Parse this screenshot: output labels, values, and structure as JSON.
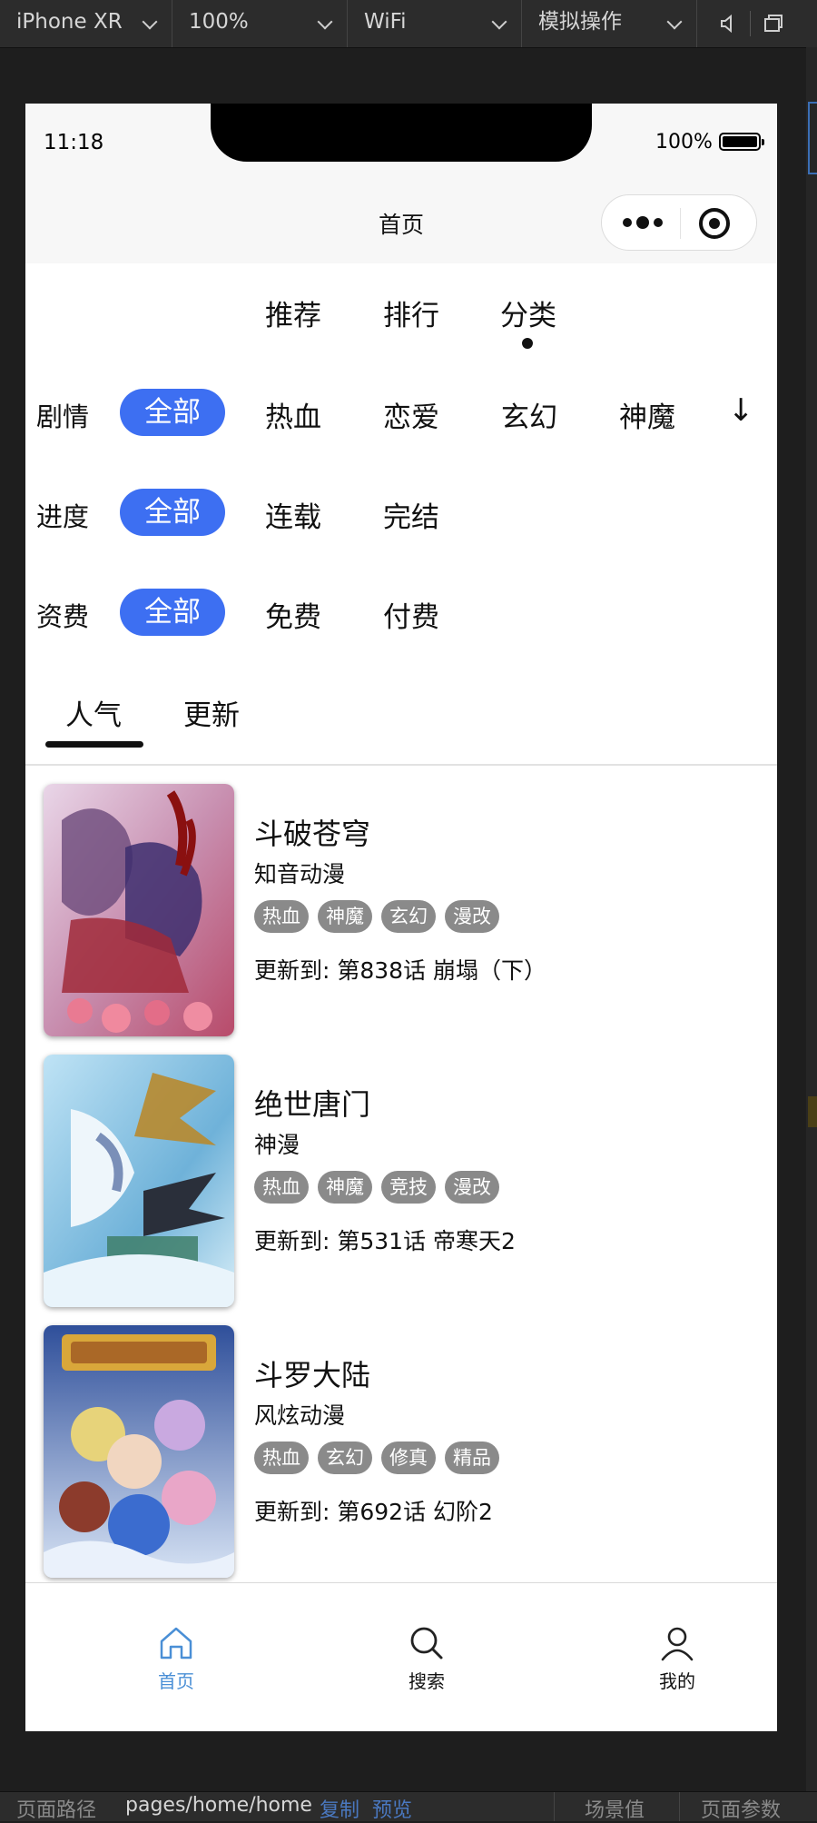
{
  "devtools": {
    "device": "iPhone XR",
    "zoom": "100%",
    "network": "WiFi",
    "simulate": "模拟操作"
  },
  "status": {
    "time": "11:18",
    "battery": "100%"
  },
  "nav": {
    "title": "首页"
  },
  "top_tabs": [
    "推荐",
    "排行",
    "分类"
  ],
  "active_top_tab": "分类",
  "filters": {
    "genre": {
      "label": "剧情",
      "options": [
        "全部",
        "热血",
        "恋爱",
        "玄幻",
        "神魔"
      ],
      "expand": "↓"
    },
    "progress": {
      "label": "进度",
      "options": [
        "全部",
        "连载",
        "完结"
      ]
    },
    "fee": {
      "label": "资费",
      "options": [
        "全部",
        "免费",
        "付费"
      ]
    }
  },
  "sort_tabs": [
    "人气",
    "更新"
  ],
  "active_sort_tab": "人气",
  "comics": [
    {
      "title": "斗破苍穹",
      "author": "知音动漫",
      "tags": [
        "热血",
        "神魔",
        "玄幻",
        "漫改"
      ],
      "update": "更新到: 第838话 崩塌（下）"
    },
    {
      "title": "绝世唐门",
      "author": "神漫",
      "tags": [
        "热血",
        "神魔",
        "竞技",
        "漫改"
      ],
      "update": "更新到: 第531话 帝寒天2"
    },
    {
      "title": "斗罗大陆",
      "author": "风炫动漫",
      "tags": [
        "热血",
        "玄幻",
        "修真",
        "精品"
      ],
      "update": "更新到: 第692话 幻阶2"
    }
  ],
  "tabbar": {
    "home": "首页",
    "search": "搜索",
    "mine": "我的",
    "active_color": "#4a8fd6"
  },
  "bottom": {
    "path_label": "页面路径",
    "path": "pages/home/home",
    "copy": "复制",
    "preview": "预览",
    "scene": "场景值",
    "params": "页面参数"
  }
}
